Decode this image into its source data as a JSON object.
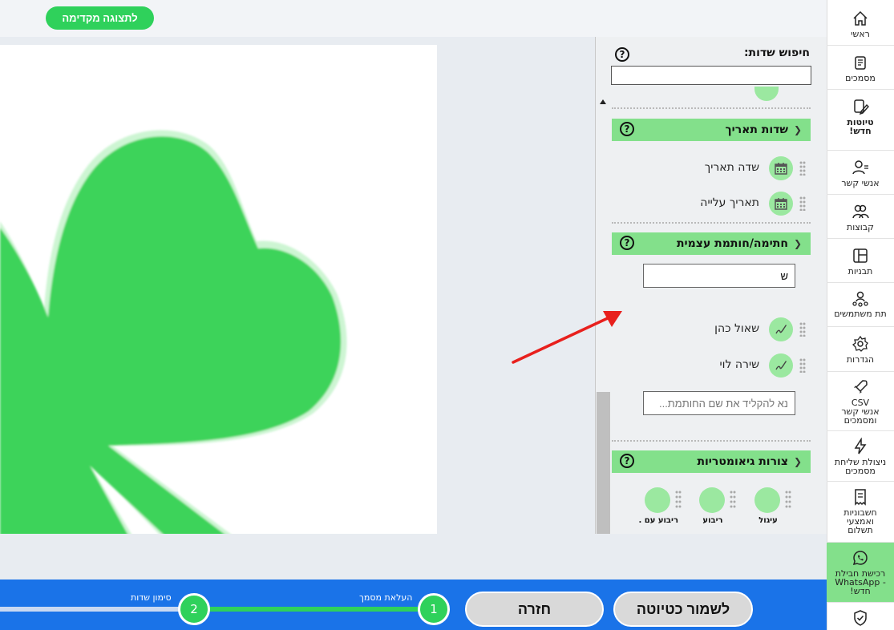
{
  "topbar": {
    "preview_label": "לתצוגה מקדימה"
  },
  "sidebar": {
    "items": [
      {
        "label": "ראשי",
        "icon": "home-icon"
      },
      {
        "label": "מסמכים",
        "icon": "documents-icon"
      },
      {
        "label": "טיוטות\nחדש!",
        "icon": "drafts-icon"
      },
      {
        "label": "אנשי קשר",
        "icon": "contacts-icon"
      },
      {
        "label": "קבוצות",
        "icon": "groups-icon"
      },
      {
        "label": "תבניות",
        "icon": "templates-icon"
      },
      {
        "label": "תת משתמשים",
        "icon": "sub-users-icon"
      },
      {
        "label": "הגדרות",
        "icon": "settings-icon"
      },
      {
        "label": "CSV\nאנשי קשר\nומסמכים",
        "icon": "rocket-icon"
      },
      {
        "label": "ניצולת שליחת\nמסמכים",
        "icon": "lightning-icon"
      },
      {
        "label": "חשבוניות\nואמצעי\nתשלום",
        "icon": "invoice-icon"
      },
      {
        "label": "רכישת חבילת\n- WhatsApp\nחדש!",
        "icon": "whatsapp-icon"
      },
      {
        "label": "",
        "icon": "shield-icon"
      }
    ]
  },
  "panel": {
    "search_label": "חיפוש שדות:",
    "search_value": "",
    "help_glyph": "?",
    "date_section": {
      "title": "שדות תאריך",
      "fields": [
        {
          "label": "שדה תאריך",
          "icon": "calendar-icon"
        },
        {
          "label": "תאריך עלייה",
          "icon": "calendar-icon"
        }
      ]
    },
    "signature_section": {
      "title": "חתימה/חותמת עצמית",
      "filter_value": "ש",
      "fields": [
        {
          "label": "שאול כהן",
          "icon": "signature-pen-icon"
        },
        {
          "label": "שירה לוי",
          "icon": "signature-pen-icon"
        }
      ],
      "stamp_placeholder": "נא להקליד את שם החותמת..."
    },
    "shapes_section": {
      "title": "צורות גיאומטריות",
      "items": [
        {
          "label": "עיגול"
        },
        {
          "label": "ריבוע"
        },
        {
          "label": "ריבוע עם ..."
        }
      ]
    }
  },
  "bottombar": {
    "save_draft_label": "לשמור כטיוטה",
    "back_label": "חזרה",
    "steps": [
      {
        "number": "1",
        "label": "העלאת מסמך"
      },
      {
        "number": "2",
        "label": "סימון שדות"
      }
    ]
  },
  "colors": {
    "brand_green": "#2fd15b",
    "section_green": "#83e08b",
    "shamrock_green": "#3ed35a",
    "bar_blue": "#1a73e8",
    "arrow_red": "#e8201d"
  }
}
